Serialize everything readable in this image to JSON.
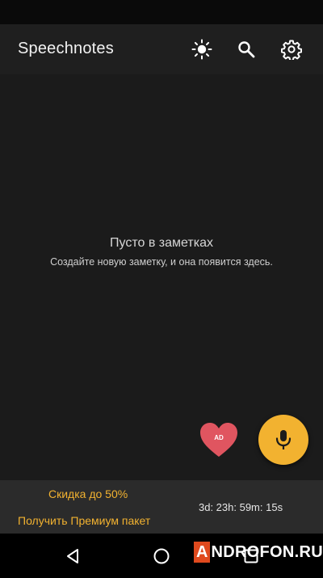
{
  "app_bar": {
    "title": "Speechnotes",
    "actions": [
      {
        "name": "theme-toggle",
        "icon": "sun-icon"
      },
      {
        "name": "search",
        "icon": "search-icon"
      },
      {
        "name": "settings",
        "icon": "gear-icon"
      }
    ]
  },
  "empty_state": {
    "title": "Пусто в заметках",
    "subtitle": "Создайте новую заметку, и она появится здесь."
  },
  "fab": {
    "ad_label": "AD",
    "ad_icon": "heart-icon",
    "mic_icon": "microphone-icon"
  },
  "promo": {
    "discount": "Скидка до 50%",
    "premium": "Получить Премиум пакет",
    "timer": "3d: 23h: 59m: 15s"
  },
  "watermark": {
    "letter": "A",
    "rest": "NDROFON.RU"
  },
  "colors": {
    "accent": "#f2b230",
    "ad_heart": "#e05560",
    "app_bar": "#1f1f1f",
    "background": "#1b1b1b",
    "promo_bar": "#2b2b2b"
  }
}
